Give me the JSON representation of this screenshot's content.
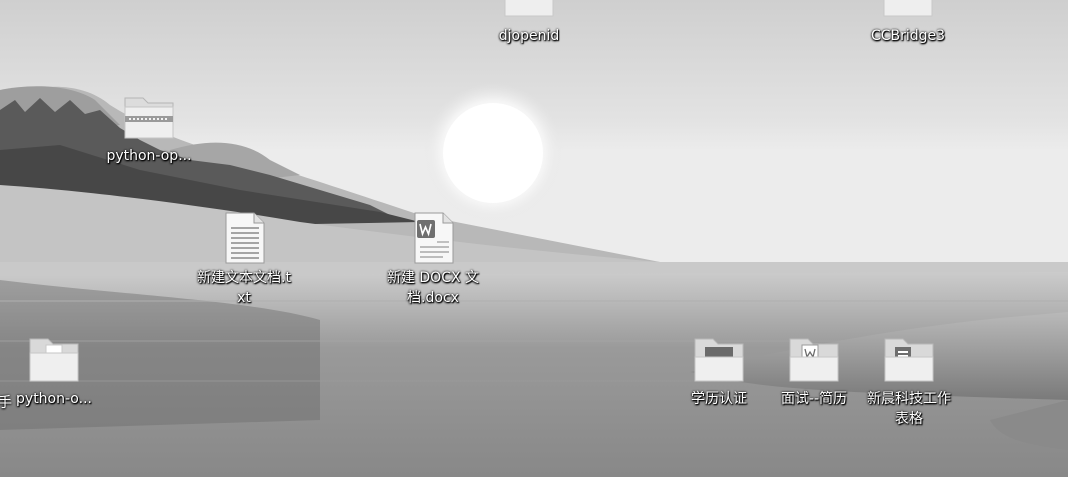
{
  "desktop": {
    "icons": [
      {
        "name": "icon-djopenid",
        "label": "djopenid",
        "kind": "folder"
      },
      {
        "name": "icon-ccbridge3",
        "label": "CCBridge3",
        "kind": "folder"
      },
      {
        "name": "icon-python-op-zip",
        "label": "python-op...",
        "kind": "zip"
      },
      {
        "name": "icon-new-text-file",
        "label": "新建文本文档.txt",
        "kind": "txt"
      },
      {
        "name": "icon-new-docx-file",
        "label": "新建 DOCX 文档.docx",
        "kind": "docx"
      },
      {
        "name": "icon-python-o-folder",
        "label": "python-o...",
        "kind": "folder"
      },
      {
        "name": "icon-education-cert-folder",
        "label": "学历认证",
        "kind": "folder"
      },
      {
        "name": "icon-interview-resume-folder",
        "label": "面试--简历",
        "kind": "folder"
      },
      {
        "name": "icon-xinchen-tech-folder",
        "label": "新晨科技工作表格",
        "kind": "folder"
      }
    ],
    "edge_label": "手"
  },
  "colors": {
    "label_text": "#ffffff",
    "label_shadow": "#000000"
  }
}
